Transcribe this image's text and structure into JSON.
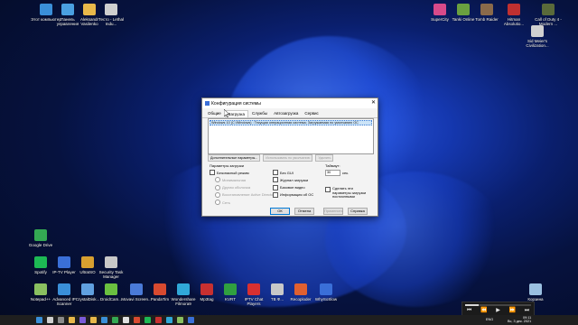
{
  "desktop_icons": [
    {
      "label": "Этот компьютер",
      "color": "#3a8fd8"
    },
    {
      "label": "Панель управления",
      "color": "#4aa0e0"
    },
    {
      "label": "Aleksandr Vasilenko",
      "color": "#e8b84a"
    },
    {
      "label": "Тесто - Lethal Indu...",
      "color": "#cfcfcf"
    },
    {
      "label": "SuperCity",
      "color": "#d84a8a"
    },
    {
      "label": "Tanki Online",
      "color": "#6aa040"
    },
    {
      "label": "Tomb Raider",
      "color": "#8a6a4a"
    },
    {
      "label": "Hitman Absolutio...",
      "color": "#c03030"
    },
    {
      "label": "Call of Duty 4 - Modern ...",
      "color": "#5a6a3a"
    },
    {
      "label": "Sid Meier's Civilization...",
      "color": "#d0d0d0"
    },
    {
      "label": "Google Drive",
      "color": "#34a853"
    },
    {
      "label": "Spotify",
      "color": "#1db954"
    },
    {
      "label": "IP-TV Player",
      "color": "#3a6fd8"
    },
    {
      "label": "UltraISO",
      "color": "#d8a030"
    },
    {
      "label": "Security Task Manager",
      "color": "#c8c8c8"
    },
    {
      "label": "Notepad++",
      "color": "#8ac060"
    },
    {
      "label": "Advanced IP Scanner",
      "color": "#3a8fd8"
    },
    {
      "label": "CrystalDisk...",
      "color": "#60a0e0"
    },
    {
      "label": "DroidCam...",
      "color": "#6ac040"
    },
    {
      "label": "Movavi Screen...",
      "color": "#4a7ad8"
    },
    {
      "label": "PandaTim",
      "color": "#d84a30"
    },
    {
      "label": "Wondershare Filmora9",
      "color": "#30a8d8"
    },
    {
      "label": "Mp3tag",
      "color": "#c83030"
    },
    {
      "label": "KVRT",
      "color": "#30a040"
    },
    {
      "label": "IPTV Chat Players",
      "color": "#d83030"
    },
    {
      "label": "ТВ Ф...",
      "color": "#c8c8c8"
    },
    {
      "label": "Recoploder",
      "color": "#e06030"
    },
    {
      "label": "WhySoSlow",
      "color": "#3a6fd8"
    },
    {
      "label": "Корзина",
      "color": "#9ac0e0"
    }
  ],
  "dialog": {
    "title": "Конфигурация системы",
    "close": "✕",
    "tabs": [
      "Общие",
      "Загрузка",
      "Службы",
      "Автозагрузка",
      "Сервис"
    ],
    "active_tab": 1,
    "os_entry": "Windows 10 (C:\\Windows) : Текущая операционная система; Загружаемая по умолчанию ОС",
    "buttons_row": {
      "advanced": "Дополнительные параметры...",
      "set_default": "Использовать по умолчанию",
      "delete": "Удалить"
    },
    "boot_options": {
      "heading": "Параметры загрузки",
      "safe_mode": "Безопасный режим",
      "minimal": "Минимальная",
      "alternate_shell": "Другая оболочка",
      "active_directory": "Восстановление Active Directory",
      "network": "Сеть",
      "no_gui": "Без GUI",
      "boot_log": "Журнал загрузки",
      "base_video": "Базовое видео",
      "os_info": "Информация об ОС"
    },
    "timeout": {
      "label": "Таймаут:",
      "value": "30",
      "unit": "сек."
    },
    "make_permanent": "Сделать эти параметры загрузки постоянными",
    "footer": {
      "ok": "ОК",
      "cancel": "Отмена",
      "apply": "Применить",
      "help": "Справка"
    }
  },
  "player": {
    "progress": 0.2,
    "controls": [
      "⏮",
      "⏪",
      "▶",
      "⏩",
      "⏭"
    ]
  },
  "taskbar": {
    "lang": "ENG",
    "time": "09:11",
    "date": "Вс, 3 дек. 2021"
  }
}
